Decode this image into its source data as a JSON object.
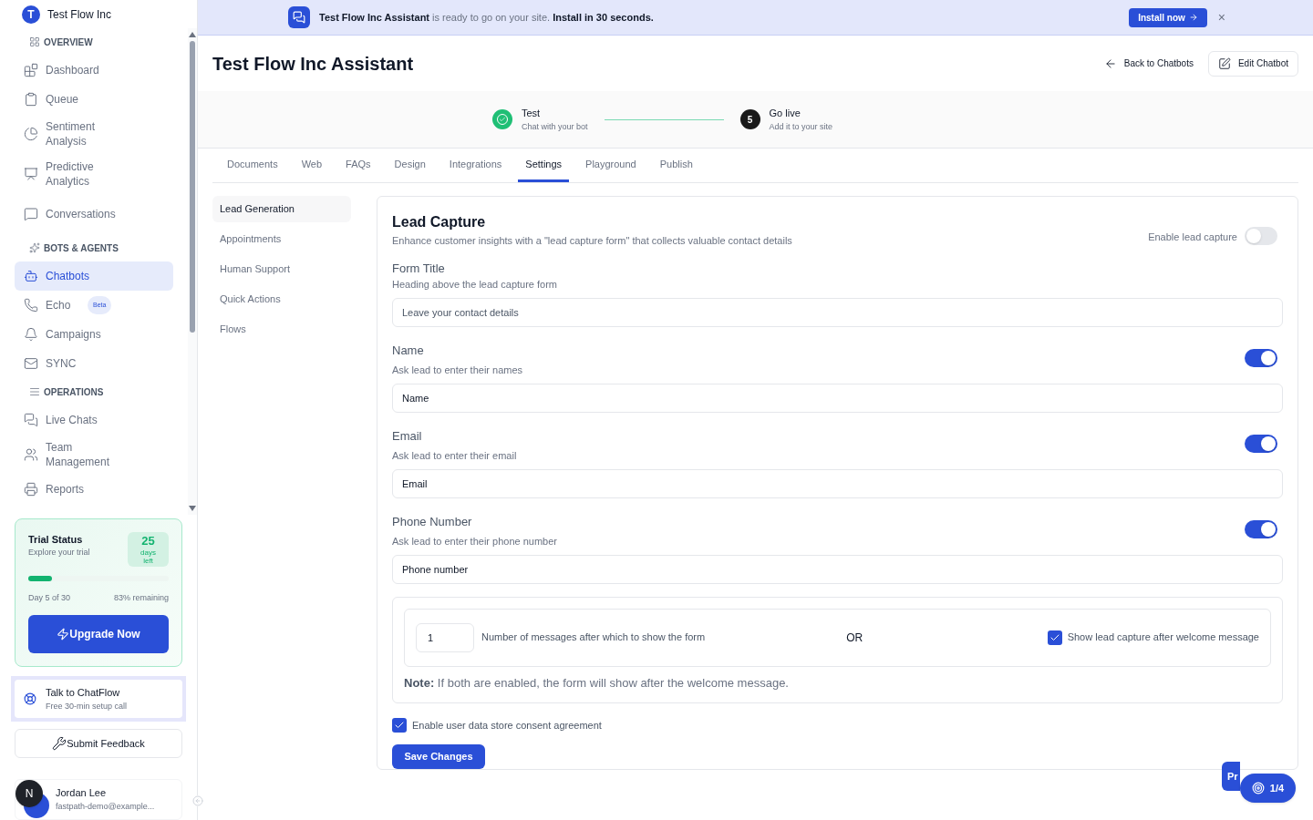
{
  "workspace": {
    "initial": "T",
    "name": "Test Flow Inc"
  },
  "sidebar": {
    "sections": [
      {
        "title": "OVERVIEW",
        "items": [
          {
            "label": "Dashboard",
            "selected": false
          },
          {
            "label": "Queue",
            "selected": false
          },
          {
            "label": "Sentiment Analysis",
            "selected": false
          },
          {
            "label": "Predictive Analytics",
            "selected": false
          },
          {
            "label": "Conversations",
            "selected": false
          }
        ]
      },
      {
        "title": "BOTS & AGENTS",
        "items": [
          {
            "label": "Chatbots",
            "selected": true
          },
          {
            "label": "Echo",
            "badge": "Beta",
            "selected": false
          },
          {
            "label": "Campaigns",
            "selected": false
          },
          {
            "label": "SYNC",
            "selected": false
          }
        ]
      },
      {
        "title": "OPERATIONS",
        "items": [
          {
            "label": "Live Chats",
            "selected": false
          },
          {
            "label": "Team Management",
            "selected": false
          },
          {
            "label": "Reports",
            "selected": false
          }
        ]
      }
    ]
  },
  "trial": {
    "title": "Trial Status",
    "subtitle": "Explore your trial",
    "days": "25",
    "days_label": "days left",
    "level": 0.17,
    "day_text": "Day 5 of 30",
    "remaining": "83% remaining",
    "button": "Upgrade Now"
  },
  "talk": {
    "title": "Talk to ChatFlow",
    "subtitle": "Free 30-min setup call"
  },
  "feedback_button": "Submit Feedback",
  "user": {
    "initial": "N",
    "name": "Jordan Lee",
    "email": "fastpath-demo@example..."
  },
  "banner": {
    "text": "**Test Flow Inc Assistant** is ready to go on your site. **Install in 30 seconds.**",
    "button": "Install now",
    "close": "×"
  },
  "page_title": "Test Flow Inc Assistant",
  "back_link": "Back to Chatbots",
  "edit_button": "Edit Chatbot",
  "steps": [
    {
      "title": "Test",
      "subtitle": "Chat with your bot",
      "done": true
    },
    {
      "title": "Go live",
      "subtitle": "Add it to your site",
      "number": "5",
      "done": false
    }
  ],
  "tabs": [
    {
      "label": "Documents",
      "selected": false
    },
    {
      "label": "Web",
      "selected": false
    },
    {
      "label": "FAQs",
      "selected": false
    },
    {
      "label": "Design",
      "selected": false
    },
    {
      "label": "Integrations",
      "selected": false
    },
    {
      "label": "Settings",
      "selected": true
    },
    {
      "label": "Playground",
      "selected": false
    },
    {
      "label": "Publish",
      "selected": false
    }
  ],
  "settings_nav": [
    {
      "label": "Lead Generation",
      "selected": true
    },
    {
      "label": "Appointments",
      "selected": false
    },
    {
      "label": "Human Support",
      "selected": false
    },
    {
      "label": "Quick Actions",
      "selected": false
    },
    {
      "label": "Flows",
      "selected": false
    }
  ],
  "lead_capture": {
    "title": "Lead Capture",
    "description": "Enhance customer insights with a \"lead capture form\" that collects valuable contact details",
    "enable_label": "Enable lead capture",
    "enabled": false,
    "form_title": {
      "label": "Form Title",
      "hint": "Heading above the lead capture form",
      "value": "Leave your contact details"
    },
    "fields": [
      {
        "label": "Name",
        "hint": "Ask lead to enter their names",
        "on": true,
        "value": "Name"
      },
      {
        "label": "Email",
        "hint": "Ask lead to enter their email",
        "on": true,
        "value": "Email"
      },
      {
        "label": "Phone Number",
        "hint": "Ask lead to enter their phone number",
        "on": true,
        "value": "Phone number"
      }
    ],
    "message_count": "1",
    "message_count_label": "Number of messages after which to show the form",
    "or": "OR",
    "after_welcome_label": "Show lead capture after welcome message",
    "after_welcome": true,
    "note": "**Note:** If both are enabled, the form will show after the welcome message.",
    "consent_label": "Enable user data store consent agreement",
    "consent": true,
    "save_button": "Save Changes"
  },
  "preview_button": "Pr",
  "tour_badge": "1/4"
}
